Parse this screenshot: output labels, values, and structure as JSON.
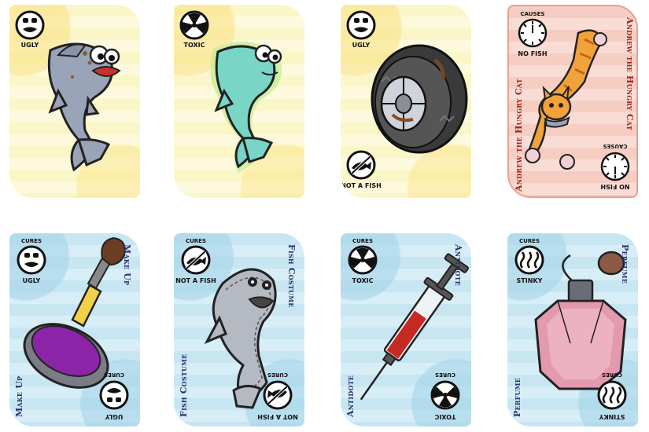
{
  "cards": {
    "ugly_fish": {
      "badge": "UGLY"
    },
    "toxic_fish": {
      "badge": "TOXIC"
    },
    "tire": {
      "badge_top": "UGLY",
      "badge_bottom": "NOT A FISH"
    },
    "cat": {
      "title": "Andrew the Hungry Cat",
      "causes": "CAUSES",
      "effect": "NO FISH"
    },
    "make_up": {
      "title": "Make Up",
      "cures": "CURES",
      "badge": "UGLY"
    },
    "fish_costume": {
      "title": "Fish Costume",
      "cures": "CURES",
      "badge": "NOT A FISH"
    },
    "antidote": {
      "title": "Antidote",
      "cures": "CURES",
      "badge": "TOXIC"
    },
    "perfume": {
      "title": "Perfume",
      "cures": "CURES",
      "badge": "STINKY"
    }
  },
  "colors": {
    "problem_card": "#fbf6c8",
    "event_card": "#f6cdc2",
    "cure_card": "#c7e6f2",
    "title_blue": "#2a2f6d",
    "title_red": "#a8201a"
  },
  "icons": [
    "ugly-face-icon",
    "radiation-icon",
    "no-fish-icon",
    "stinky-icon",
    "clock-icon"
  ]
}
